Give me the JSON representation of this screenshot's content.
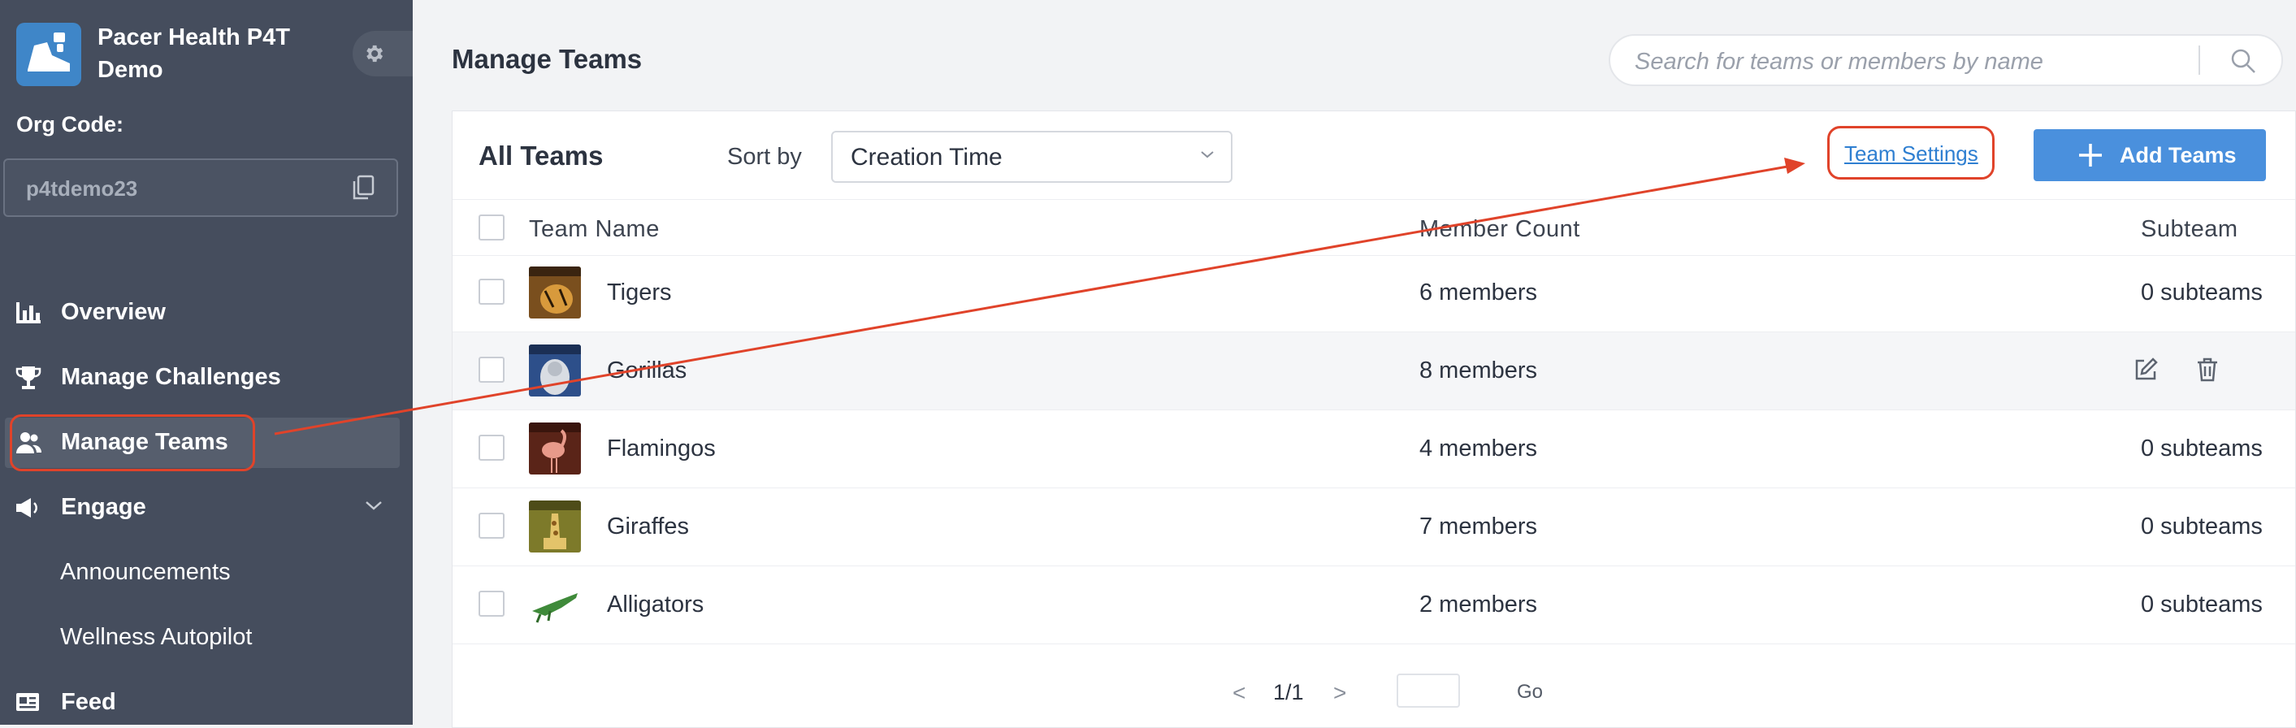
{
  "sidebar": {
    "app_title": "Pacer Health P4T Demo",
    "org_label": "Org Code:",
    "org_code": "p4tdemo23",
    "nav": [
      {
        "label": "Overview",
        "icon": "bar-chart-icon"
      },
      {
        "label": "Manage Challenges",
        "icon": "trophy-icon"
      },
      {
        "label": "Manage Teams",
        "icon": "people-icon",
        "active": true
      },
      {
        "label": "Engage",
        "icon": "megaphone-icon"
      },
      {
        "label": "Announcements"
      },
      {
        "label": "Wellness Autopilot"
      },
      {
        "label": "Feed",
        "icon": "feed-icon"
      }
    ]
  },
  "header": {
    "page_title": "Manage Teams",
    "search_placeholder": "Search for teams or members by name"
  },
  "toolbar": {
    "all_teams": "All Teams",
    "sort_label": "Sort by",
    "sort_value": "Creation Time",
    "team_settings": "Team Settings",
    "add_teams": "Add Teams"
  },
  "table": {
    "columns": [
      "Team Name",
      "Member Count",
      "Subteam"
    ],
    "rows": [
      {
        "name": "Tigers",
        "count": "6 members",
        "subteam": "0 subteams"
      },
      {
        "name": "Gorillas",
        "count": "8 members",
        "subteam": ""
      },
      {
        "name": "Flamingos",
        "count": "4 members",
        "subteam": "0 subteams"
      },
      {
        "name": "Giraffes",
        "count": "7 members",
        "subteam": "0 subteams"
      },
      {
        "name": "Alligators",
        "count": "2 members",
        "subteam": "0 subteams"
      }
    ]
  },
  "pagination": {
    "prev": "<",
    "page": "1/1",
    "next": ">",
    "go": "Go"
  },
  "colors": {
    "sidebar_bg": "#454d5d",
    "accent": "#4a90dd",
    "annotation": "#e0432a"
  }
}
